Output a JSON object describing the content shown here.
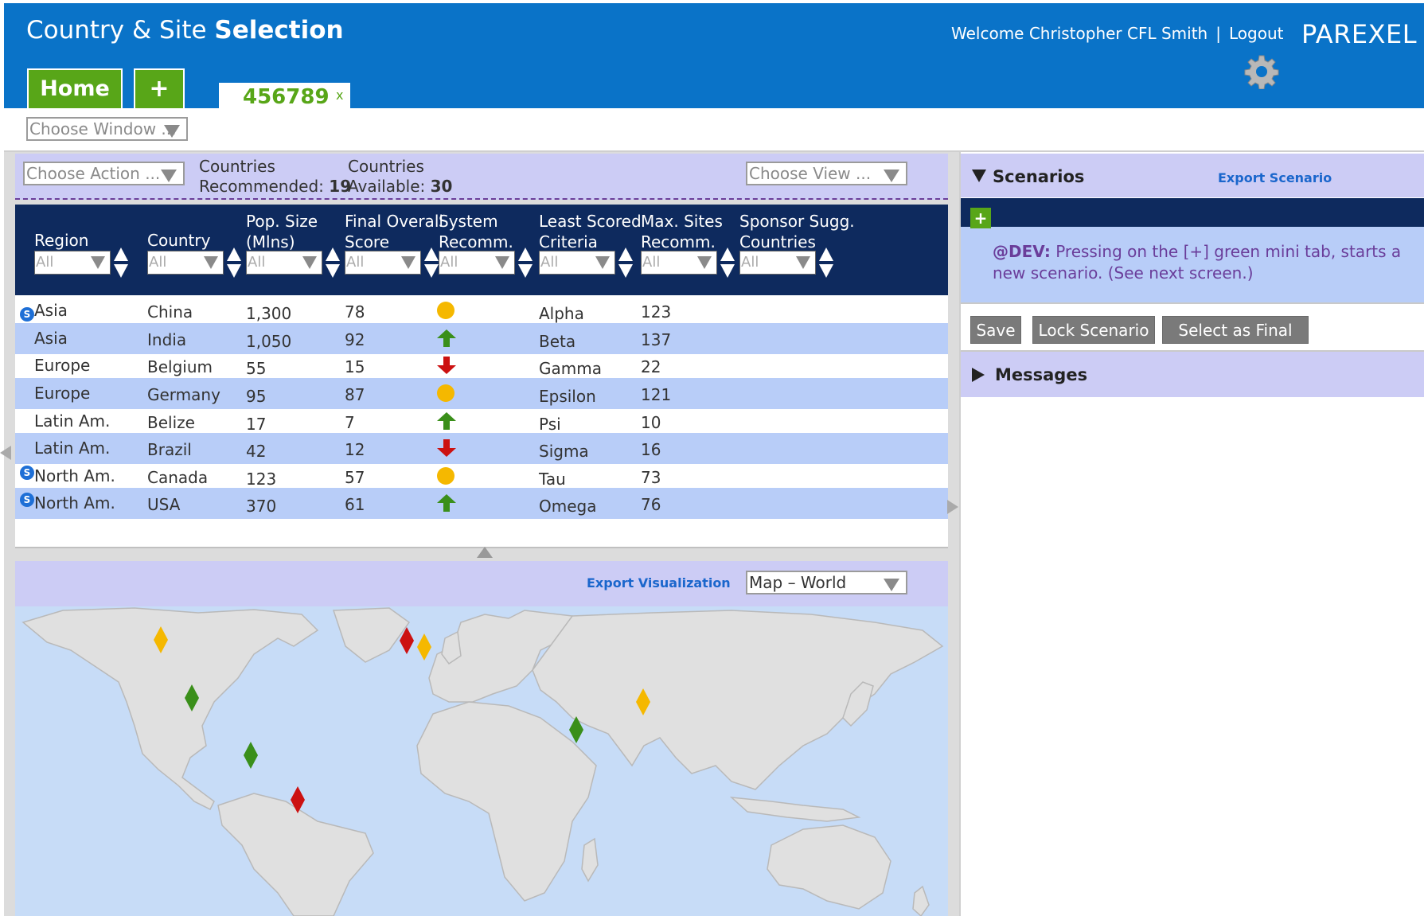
{
  "header": {
    "title_light": "Country & Site",
    "title_bold": "Selection",
    "welcome": "Welcome Christopher CFL Smith",
    "separator": "|",
    "logout": "Logout",
    "brand": "PAREXEL"
  },
  "tabs": {
    "home": "Home",
    "add": "+",
    "active": "456789",
    "close": "x"
  },
  "window_select": {
    "placeholder": "Choose Window ..."
  },
  "action_bar": {
    "action_placeholder": "Choose Action ...",
    "recommended_label1": "Countries",
    "recommended_label2": "Recommended:",
    "recommended_value": "19",
    "available_label1": "Countries",
    "available_label2": "Available:",
    "available_value": "30",
    "view_placeholder": "Choose View ..."
  },
  "table": {
    "filter_default": "All",
    "headers": [
      [
        "",
        "Region"
      ],
      [
        "",
        "Country"
      ],
      [
        "Pop. Size",
        "(Mlns)"
      ],
      [
        "Final Overall",
        "Score"
      ],
      [
        "System",
        "Recomm."
      ],
      [
        "Least Scored",
        "Criteria"
      ],
      [
        "Max. Sites",
        "Recomm."
      ],
      [
        "Sponsor Sugg.",
        "Countries"
      ]
    ],
    "rows": [
      {
        "badge": "S",
        "region": "Asia",
        "country": "China",
        "pop": "1,300",
        "score": "78",
        "recomm": "neutral",
        "criteria": "Alpha",
        "sites": "123"
      },
      {
        "badge": "",
        "region": "Asia",
        "country": "India",
        "pop": "1,050",
        "score": "92",
        "recomm": "up",
        "criteria": "Beta",
        "sites": "137"
      },
      {
        "badge": "",
        "region": "Europe",
        "country": "Belgium",
        "pop": "55",
        "score": "15",
        "recomm": "down",
        "criteria": "Gamma",
        "sites": "22"
      },
      {
        "badge": "",
        "region": "Europe",
        "country": "Germany",
        "pop": "95",
        "score": "87",
        "recomm": "neutral",
        "criteria": "Epsilon",
        "sites": "121"
      },
      {
        "badge": "",
        "region": "Latin Am.",
        "country": "Belize",
        "pop": "17",
        "score": "7",
        "recomm": "up",
        "criteria": "Psi",
        "sites": "10"
      },
      {
        "badge": "",
        "region": "Latin Am.",
        "country": "Brazil",
        "pop": "42",
        "score": "12",
        "recomm": "down",
        "criteria": "Sigma",
        "sites": "16"
      },
      {
        "badge": "S",
        "region": "North Am.",
        "country": "Canada",
        "pop": "123",
        "score": "57",
        "recomm": "neutral",
        "criteria": "Tau",
        "sites": "73"
      },
      {
        "badge": "S",
        "region": "North Am.",
        "country": "USA",
        "pop": "370",
        "score": "61",
        "recomm": "up",
        "criteria": "Omega",
        "sites": "76"
      }
    ]
  },
  "visualization": {
    "export_label": "Export Visualization",
    "map_select": "Map – World"
  },
  "scenarios": {
    "title": "Scenarios",
    "export": "Export Scenario",
    "mini_add": "+",
    "dev_label": "@DEV:",
    "dev_text": "Pressing on the [+] green mini tab, starts a new scenario. (See next screen.)",
    "save": "Save",
    "lock": "Lock Scenario",
    "select_final": "Select as Final"
  },
  "messages": {
    "title": "Messages"
  },
  "colors": {
    "header_blue": "#0a73c8",
    "tab_green": "#58a618",
    "table_header": "#0e2a5e",
    "row_alt": "#b8cdf8",
    "panel_lavender": "#ccccf5",
    "recomm_up": "#3a8f1a",
    "recomm_down": "#cc1111",
    "recomm_neutral": "#f5b800"
  }
}
